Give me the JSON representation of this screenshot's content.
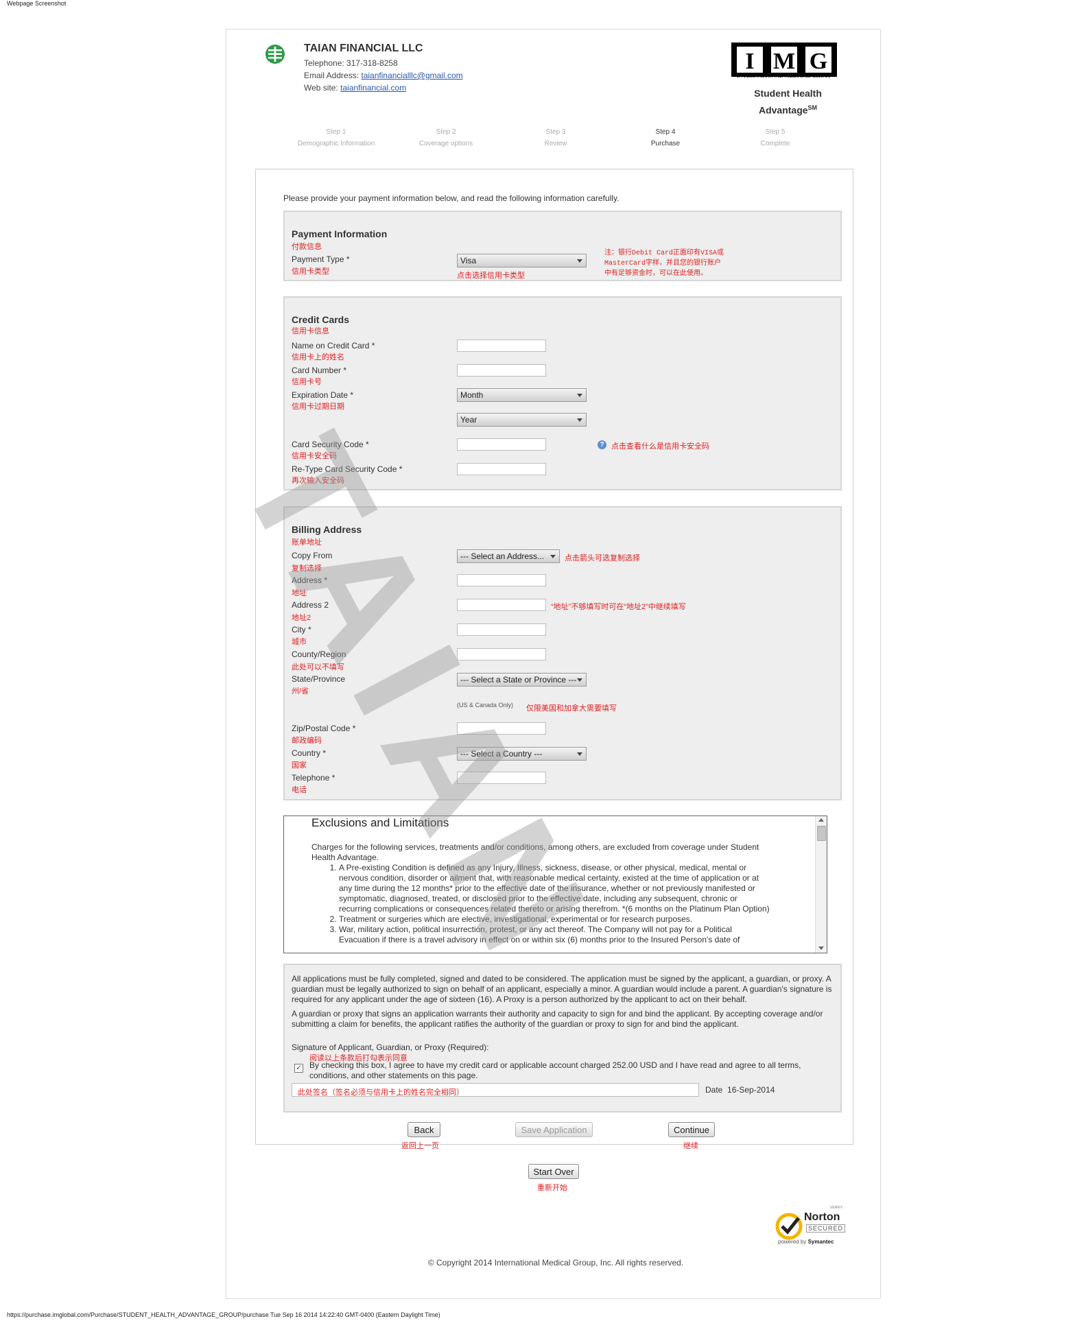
{
  "screenshot_label": "Webpage Screenshot",
  "company": {
    "name": "TAIAN FINANCIAL LLC",
    "telephone": "Telephone: 317-318-8258",
    "email_label": "Email Address: ",
    "email": "taianfinancialllc@gmail.com",
    "website_label": "Web site: ",
    "website": "taianfinancial.com"
  },
  "brand": {
    "logo_letters": [
      "I",
      "M",
      "G"
    ],
    "logo_subtitle": "INTERNATIONAL MEDICAL GROUP",
    "product_line1": "Student Health",
    "product_line2": "Advantage",
    "product_mark": "SM"
  },
  "steps": [
    {
      "num": "Step 1",
      "label": "Demographic Information"
    },
    {
      "num": "Step 2",
      "label": "Coverage options"
    },
    {
      "num": "Step 3",
      "label": "Review"
    },
    {
      "num": "Step 4",
      "label": "Purchase"
    },
    {
      "num": "Step 5",
      "label": "Complete"
    }
  ],
  "intro": "Please provide your payment information below, and read the following information carefully.",
  "payment": {
    "title": "Payment Information",
    "title_cn": "付款信息",
    "type_label": "Payment Type *",
    "type_cn": "信用卡类型",
    "type_value": "Visa",
    "type_hint_cn": "点击选择信用卡类型",
    "note_cn_1": "注：银行Debit Card正面印有VISA或",
    "note_cn_2": "MasterCard字样，并且您的银行账户",
    "note_cn_3": "中有足够资金时，可以在此使用。"
  },
  "credit": {
    "title": "Credit Cards",
    "title_cn": "信用卡信息",
    "name_label": "Name on Credit Card *",
    "name_cn": "信用卡上的姓名",
    "number_label": "Card Number *",
    "number_cn": "信用卡号",
    "exp_label": "Expiration Date *",
    "exp_cn": "信用卡过期日期",
    "month": "Month",
    "year": "Year",
    "cvv_label": "Card Security Code *",
    "cvv_cn": "信用卡安全码",
    "cvv_help_cn": "点击查看什么是信用卡安全码",
    "cvv2_label": "Re-Type Card Security Code *",
    "cvv2_cn": "再次输入安全码"
  },
  "billing": {
    "title": "Billing Address",
    "title_cn": "账单地址",
    "copy_label": "Copy From",
    "copy_cn": "复制选择",
    "copy_value": "--- Select an Address...",
    "copy_hint_cn": "点击箭头可选复制选择",
    "addr_label": "Address *",
    "addr_cn": "地址",
    "addr2_label": "Address 2",
    "addr2_cn": "地址2",
    "addr2_hint_cn": "“地址”不够填写时可在“地址2”中继续填写",
    "city_label": "City *",
    "city_cn": "城市",
    "county_label": "County/Region",
    "county_cn": "此处可以不填写",
    "state_label": "State/Province",
    "state_cn": "州/省",
    "state_value": "--- Select a State or Province ---",
    "state_note": "(US & Canada Only)",
    "state_note_cn": "仅限美国和加拿大需要填写",
    "zip_label": "Zip/Postal Code *",
    "zip_cn": "邮政编码",
    "country_label": "Country *",
    "country_cn": "国家",
    "country_value": "--- Select a Country ---",
    "phone_label": "Telephone *",
    "phone_cn": "电话"
  },
  "exclusions": {
    "title": "Exclusions and Limitations",
    "intro": "Charges for the following services, treatments and/or conditions, among others, are excluded from coverage under Student Health Advantage.",
    "items": [
      "A Pre-existing Condition is defined as any Injury, Illness, sickness, disease, or other physical, medical, mental or nervous condition, disorder or ailment that, with reasonable medical certainty, existed at the time of application or at any time during the 12 months* prior to the effective date of the insurance, whether or not previously manifested or symptomatic, diagnosed, treated, or disclosed prior to the effective date, including any subsequent, chronic or recurring complications or consequences related thereto or arising therefrom. *(6 months on the Platinum Plan Option)",
      "Treatment or surgeries which are elective, investigational, experimental or for research purposes.",
      "War, military action, political insurrection, protest, or any act thereof. The Company will not pay for a Political Evacuation if there is a travel advisory in effect on or within six (6) months prior to the Insured Person's date of"
    ]
  },
  "legal": {
    "p1": "All applications must be fully completed, signed and dated to be considered. The application must be signed by the applicant, a guardian, or proxy. A guardian must be legally authorized to sign on behalf of an applicant, especially a minor. A guardian would include a parent. A guardian's signature is required for any applicant under the age of sixteen (16). A Proxy is a person authorized by the applicant to act on their behalf.",
    "p2": "A guardian or proxy that signs an application warrants their authority and capacity to sign for and bind the applicant. By accepting coverage and/or submitting a claim for benefits, the applicant ratifies the authority of the guardian or proxy to sign for and bind the applicant.",
    "sig_label": "Signature of Applicant, Guardian, or Proxy (Required):",
    "check_cn": "阅读以上条款后打勾表示同意",
    "agree": "By checking this box, I agree to have my credit card or applicable account charged 252.00 USD and I have read and agree to all terms, conditions, and other statements on this page.",
    "sig_cn": "此处签名（签名必须与信用卡上的姓名完全相同）",
    "date_label": "Date",
    "date_value": "16-Sep-2014"
  },
  "buttons": {
    "back": "Back",
    "back_cn": "返回上一页",
    "save": "Save Application",
    "continue": "Continue",
    "continue_cn": "继续",
    "start_over": "Start Over",
    "start_over_cn": "重新开始"
  },
  "norton": {
    "verify": "VERIFY",
    "name": "Norton",
    "secured": "SECURED",
    "powered": "powered by ",
    "symantec": "Symantec"
  },
  "copyright": "© Copyright 2014 International Medical Group, Inc. All rights reserved.",
  "watermark": "TAIAN",
  "footer_url": "https://purchase.imglobal.com/Purchase/STUDENT_HEALTH_ADVANTAGE_GROUP/purchase Tue Sep 16 2014 14:22:40 GMT-0400 (Eastern Daylight Time)"
}
